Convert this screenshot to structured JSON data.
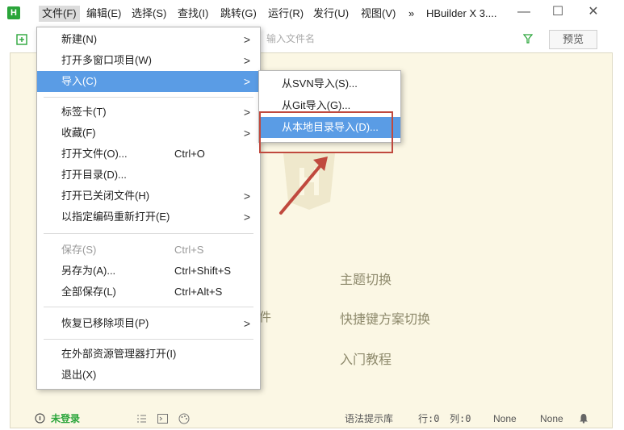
{
  "app": {
    "logo_letter": "H",
    "window_title": "HBuilder X 3...."
  },
  "menubar": [
    {
      "label": "文件(F)",
      "active": true
    },
    {
      "label": "编辑(E)"
    },
    {
      "label": "选择(S)"
    },
    {
      "label": "查找(I)"
    },
    {
      "label": "跳转(G)"
    },
    {
      "label": "运行(R)"
    },
    {
      "label": "发行(U)"
    },
    {
      "label": "视图(V)"
    },
    {
      "label": "»"
    }
  ],
  "window_controls": {
    "minimize": "—",
    "maximize": "☐",
    "close": "✕"
  },
  "toolbar": {
    "search_placeholder": "输入文件名",
    "preview_label": "预览"
  },
  "file_menu": [
    {
      "label": "新建(N)",
      "arrow": ">"
    },
    {
      "label": "打开多窗口项目(W)",
      "arrow": ">"
    },
    {
      "label": "导入(C)",
      "arrow": ">",
      "highlight": true
    },
    {
      "sep": true
    },
    {
      "label": "标签卡(T)",
      "arrow": ">"
    },
    {
      "label": "收藏(F)",
      "arrow": ">"
    },
    {
      "label": "打开文件(O)...",
      "shortcut": "Ctrl+O"
    },
    {
      "label": "打开目录(D)..."
    },
    {
      "label": "打开已关闭文件(H)",
      "arrow": ">"
    },
    {
      "label": "以指定编码重新打开(E)",
      "arrow": ">"
    },
    {
      "sep": true
    },
    {
      "label": "保存(S)",
      "shortcut": "Ctrl+S",
      "disabled": true
    },
    {
      "label": "另存为(A)...",
      "shortcut": "Ctrl+Shift+S"
    },
    {
      "label": "全部保存(L)",
      "shortcut": "Ctrl+Alt+S"
    },
    {
      "sep": true
    },
    {
      "label": "恢复已移除项目(P)",
      "arrow": ">"
    },
    {
      "sep": true
    },
    {
      "label": "在外部资源管理器打开(I)"
    },
    {
      "label": "退出(X)"
    }
  ],
  "import_submenu": [
    {
      "label": "从SVN导入(S)..."
    },
    {
      "label": "从Git导入(G)..."
    },
    {
      "label": "从本地目录导入(D)...",
      "highlight": true
    }
  ],
  "welcome": {
    "links": [
      "主题切换",
      "快捷键方案切换",
      "入门教程"
    ],
    "partial_text": "件"
  },
  "statusbar": {
    "login": "未登录",
    "syntax_lib": "语法提示库",
    "row": "行:0",
    "col": "列:0",
    "enc1": "None",
    "enc2": "None"
  },
  "colors": {
    "highlight": "#5a9ce5",
    "editor_bg": "#fbf7e4",
    "annotation": "#c0493e",
    "logo": "#2aa53a"
  }
}
